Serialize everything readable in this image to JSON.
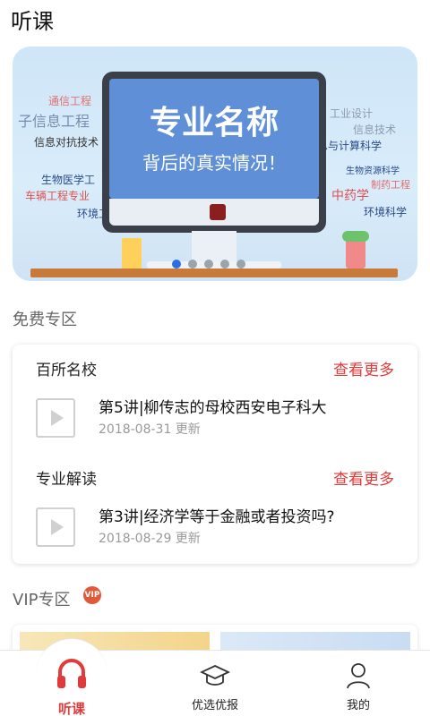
{
  "header": {
    "title": "听课"
  },
  "banner": {
    "title_line1": "专业名称",
    "title_line2": "背后的真实情况！",
    "keywords_left": [
      "通信工程",
      "子信息工程",
      "信息对抗技术",
      "生物医学工",
      "车辆工程专业",
      "环境工"
    ],
    "keywords_right": [
      "工业设计",
      "信息技术",
      "息与计算科学",
      "生物资源科学",
      "中药学",
      "制药工程",
      "环境科学"
    ],
    "page_count": 5,
    "active_page": 1
  },
  "free_section": {
    "title": "免费专区",
    "categories": [
      {
        "label": "百所名校",
        "more": "查看更多",
        "lesson_title": "第5讲|柳传志的母校西安电子科大",
        "lesson_date": "2018-08-31 更新"
      },
      {
        "label": "专业解读",
        "more": "查看更多",
        "lesson_title": "第3讲|经济学等于金融或者投资吗?",
        "lesson_date": "2018-08-29 更新"
      }
    ]
  },
  "vip_section": {
    "title": "VIP专区",
    "badge": "VIP"
  },
  "tabbar": {
    "items": [
      {
        "label": "听课",
        "icon": "headphones-icon"
      },
      {
        "label": "优选优报",
        "icon": "graduation-cap-icon"
      },
      {
        "label": "我的",
        "icon": "user-icon"
      }
    ]
  },
  "colors": {
    "accent": "#e03a3a",
    "active_dot": "#2d6fe0"
  }
}
